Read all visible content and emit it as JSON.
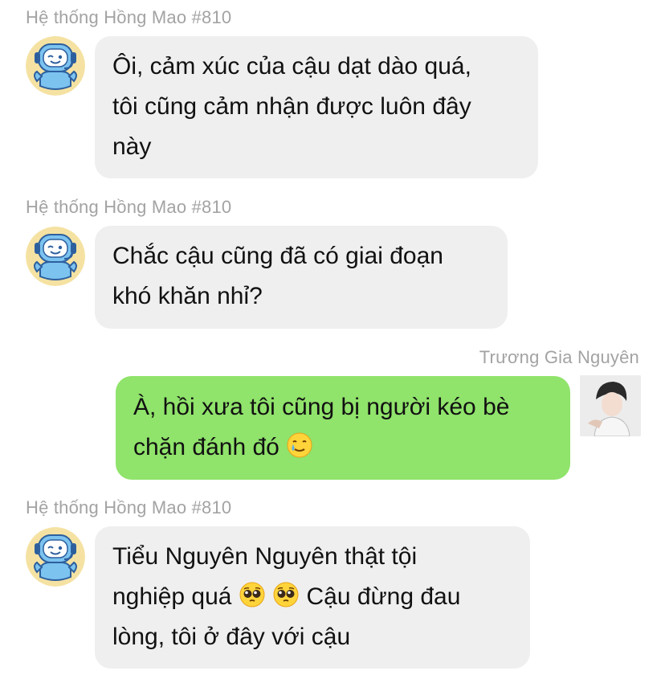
{
  "messages": [
    {
      "sender": "Hệ thống Hồng Mao #810",
      "lines": [
        "Ôi, cảm xúc của cậu dạt dào quá,",
        "tôi cũng cảm nhận được luôn đây",
        "này"
      ]
    },
    {
      "sender": "Hệ thống Hồng Mao #810",
      "lines": [
        "Chắc cậu cũng đã có giai đoạn",
        "khó khăn nhỉ?"
      ]
    },
    {
      "sender": "Trương Gia Nguyên",
      "lines": [
        "À, hồi xưa tôi cũng bị người kéo bè",
        "chặn đánh đó"
      ],
      "emoji": "smiling-face-with-tear-emoji"
    },
    {
      "sender": "Hệ thống Hồng Mao #810",
      "lines": [
        "Tiểu Nguyên Nguyên thật tội",
        "nghiệp quá",
        "Cậu đừng đau",
        "lòng, tôi ở đây với cậu"
      ],
      "emoji": "pleading-face-emoji"
    }
  ],
  "colors": {
    "incoming_bubble": "#efefef",
    "outgoing_bubble": "#90e36b",
    "sender_name": "#a3a3a3"
  }
}
